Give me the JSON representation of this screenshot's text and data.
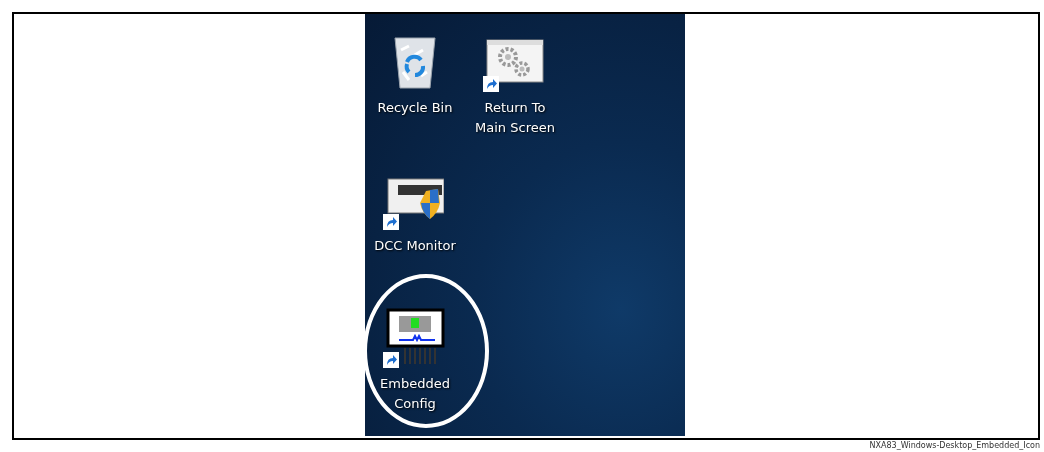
{
  "desktop": {
    "columns": [
      [
        {
          "kind": "recycle",
          "label": "Recycle Bin",
          "shortcut": false,
          "highlighted": false
        },
        {
          "kind": "monitor",
          "label": "DCC Monitor",
          "shortcut": true,
          "highlighted": false
        },
        {
          "kind": "device",
          "label": "Embedded Config",
          "shortcut": true,
          "highlighted": true
        }
      ],
      [
        {
          "kind": "gears",
          "label": "Return To Main Screen",
          "shortcut": true,
          "highlighted": false
        }
      ]
    ]
  },
  "caption": "NXA83_Windows-Desktop_Embedded_Icon"
}
